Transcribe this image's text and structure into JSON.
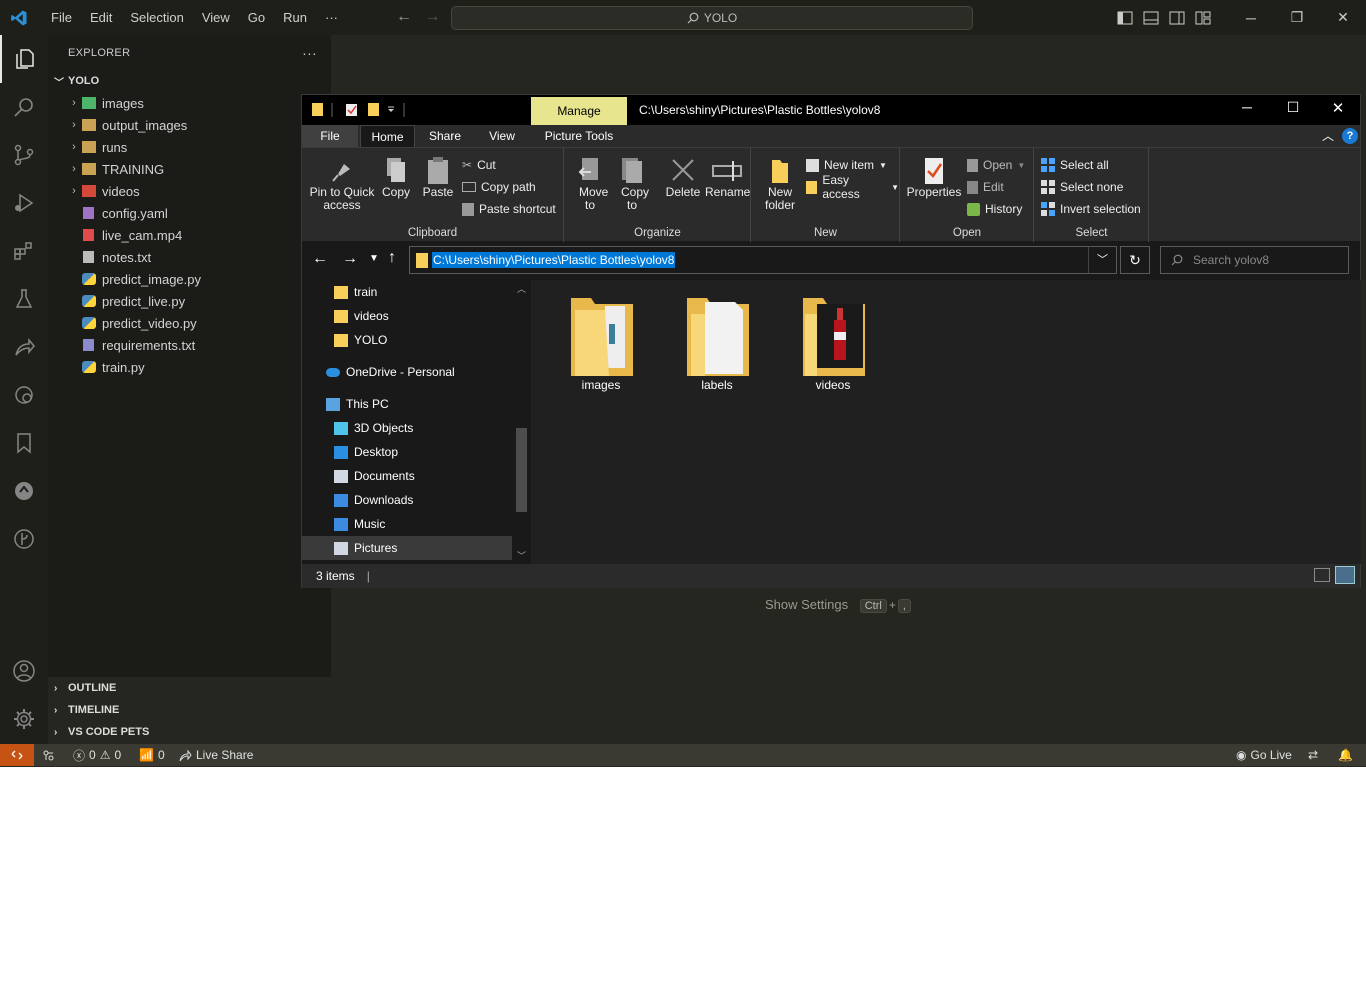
{
  "vscode": {
    "menu": [
      "File",
      "Edit",
      "Selection",
      "View",
      "Go",
      "Run",
      "···"
    ],
    "search_label": "YOLO",
    "sidebar": {
      "header": "EXPLORER",
      "more": "···",
      "root": "YOLO",
      "items": [
        {
          "label": "images",
          "type": "folder",
          "icon": "images-folder-icon"
        },
        {
          "label": "output_images",
          "type": "folder",
          "icon": "folder-icon"
        },
        {
          "label": "runs",
          "type": "folder",
          "icon": "folder-icon"
        },
        {
          "label": "TRAINING",
          "type": "folder",
          "icon": "folder-icon"
        },
        {
          "label": "videos",
          "type": "folder",
          "icon": "video-folder-icon"
        },
        {
          "label": "config.yaml",
          "type": "file",
          "icon": "yaml-icon"
        },
        {
          "label": "live_cam.mp4",
          "type": "file",
          "icon": "video-file-icon"
        },
        {
          "label": "notes.txt",
          "type": "file",
          "icon": "text-file-icon"
        },
        {
          "label": "predict_image.py",
          "type": "file",
          "icon": "python-icon"
        },
        {
          "label": "predict_live.py",
          "type": "file",
          "icon": "python-icon"
        },
        {
          "label": "predict_video.py",
          "type": "file",
          "icon": "python-icon"
        },
        {
          "label": "requirements.txt",
          "type": "file",
          "icon": "requirements-icon"
        },
        {
          "label": "train.py",
          "type": "file",
          "icon": "python-icon"
        }
      ],
      "sections": [
        "OUTLINE",
        "TIMELINE",
        "VS CODE PETS"
      ]
    },
    "show_settings": {
      "label": "Show Settings",
      "keys": [
        "Ctrl",
        "+",
        ","
      ]
    },
    "status": {
      "errors": "0",
      "warnings": "0",
      "ports": "0",
      "live_share": "Live Share",
      "go_live": "Go Live"
    }
  },
  "explorer": {
    "manage_tab": "Manage",
    "path_title": "C:\\Users\\shiny\\Pictures\\Plastic Bottles\\yolov8",
    "tabs": [
      "File",
      "Home",
      "Share",
      "View",
      "Picture Tools"
    ],
    "ribbon": {
      "clipboard": {
        "label": "Clipboard",
        "pin": "Pin to Quick access",
        "copy": "Copy",
        "paste": "Paste",
        "cut": "Cut",
        "copy_path": "Copy path",
        "paste_shortcut": "Paste shortcut"
      },
      "organize": {
        "label": "Organize",
        "move_to": "Move to",
        "copy_to": "Copy to",
        "delete": "Delete",
        "rename": "Rename"
      },
      "new": {
        "label": "New",
        "new_folder": "New folder",
        "new_item": "New item",
        "easy_access": "Easy access"
      },
      "open": {
        "label": "Open",
        "properties": "Properties",
        "open": "Open",
        "edit": "Edit",
        "history": "History"
      },
      "select": {
        "label": "Select",
        "select_all": "Select all",
        "select_none": "Select none",
        "invert": "Invert selection"
      }
    },
    "address": "C:\\Users\\shiny\\Pictures\\Plastic Bottles\\yolov8",
    "search_placeholder": "Search yolov8",
    "nav": [
      {
        "label": "train",
        "icon": "folder-icon"
      },
      {
        "label": "videos",
        "icon": "folder-icon"
      },
      {
        "label": "YOLO",
        "icon": "folder-icon"
      },
      {
        "label": "OneDrive - Personal",
        "icon": "onedrive-icon"
      },
      {
        "label": "This PC",
        "icon": "pc-icon"
      },
      {
        "label": "3D Objects",
        "icon": "3d-objects-icon"
      },
      {
        "label": "Desktop",
        "icon": "desktop-icon"
      },
      {
        "label": "Documents",
        "icon": "documents-icon"
      },
      {
        "label": "Downloads",
        "icon": "downloads-icon"
      },
      {
        "label": "Music",
        "icon": "music-icon"
      },
      {
        "label": "Pictures",
        "icon": "pictures-icon"
      }
    ],
    "folders": [
      "images",
      "labels",
      "videos"
    ],
    "status_count": "3 items"
  },
  "colors": {
    "accent": "#0078d7",
    "manage_tab": "#e7e68f",
    "remote": "#c65314"
  }
}
